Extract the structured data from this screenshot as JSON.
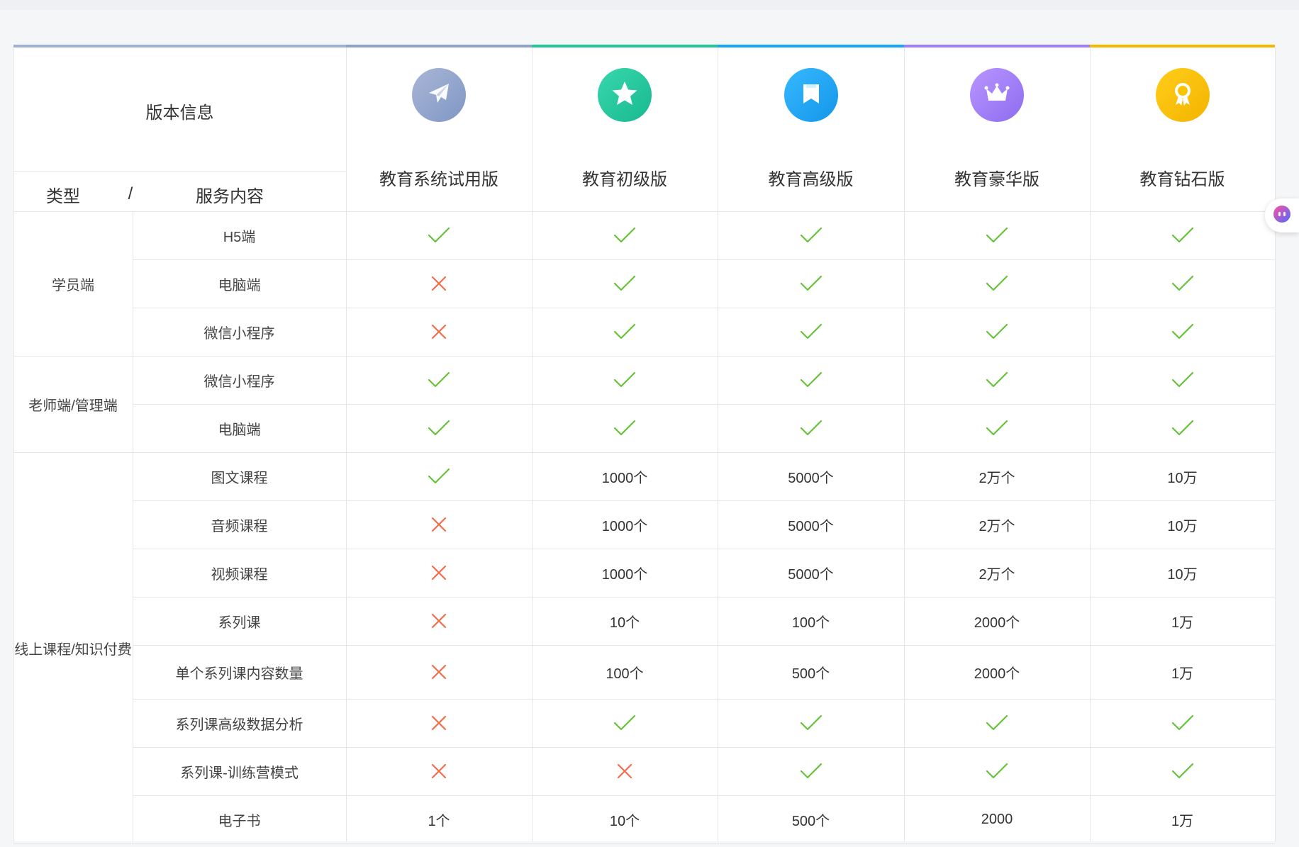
{
  "header": {
    "version_info": "版本信息",
    "type_label": "类型",
    "separator": "/",
    "service_label": "服务内容"
  },
  "plans": [
    {
      "name": "教育系统试用版",
      "icon": "paper-plane-icon",
      "color": "#8fa2c9",
      "gradient": [
        "#a9b6d6",
        "#7f97c4"
      ]
    },
    {
      "name": "教育初级版",
      "icon": "star-icon",
      "color": "#26c59a",
      "gradient": [
        "#38d7ad",
        "#19b98f"
      ]
    },
    {
      "name": "教育高级版",
      "icon": "bookmark-icon",
      "color": "#1aa6f1",
      "gradient": [
        "#36b8ff",
        "#1496ea"
      ]
    },
    {
      "name": "教育豪华版",
      "icon": "crown-icon",
      "color": "#a07ef5",
      "gradient": [
        "#b996ff",
        "#8d6cf0"
      ]
    },
    {
      "name": "教育钻石版",
      "icon": "medal-icon",
      "color": "#f5b800",
      "gradient": [
        "#ffcd1a",
        "#f3b400"
      ]
    }
  ],
  "categories": [
    {
      "label": "学员端",
      "rows": [
        {
          "service": "H5端",
          "values": [
            "✓",
            "✓",
            "✓",
            "✓",
            "✓"
          ]
        },
        {
          "service": "电脑端",
          "values": [
            "✗",
            "✓",
            "✓",
            "✓",
            "✓"
          ]
        },
        {
          "service": "微信小程序",
          "values": [
            "✗",
            "✓",
            "✓",
            "✓",
            "✓"
          ]
        }
      ]
    },
    {
      "label": "老师端/管理端",
      "rows": [
        {
          "service": "微信小程序",
          "values": [
            "✓",
            "✓",
            "✓",
            "✓",
            "✓"
          ]
        },
        {
          "service": "电脑端",
          "values": [
            "✓",
            "✓",
            "✓",
            "✓",
            "✓"
          ]
        }
      ]
    },
    {
      "label": "线上课程/知识付费",
      "rows": [
        {
          "service": "图文课程",
          "values": [
            "✓",
            "1000个",
            "5000个",
            "2万个",
            "10万"
          ]
        },
        {
          "service": "音频课程",
          "values": [
            "✗",
            "1000个",
            "5000个",
            "2万个",
            "10万"
          ]
        },
        {
          "service": "视频课程",
          "values": [
            "✗",
            "1000个",
            "5000个",
            "2万个",
            "10万"
          ]
        },
        {
          "service": "系列课",
          "values": [
            "✗",
            "10个",
            "100个",
            "2000个",
            "1万"
          ]
        },
        {
          "service": "单个系列课内容数量",
          "values": [
            "✗",
            "100个",
            "500个",
            "2000个",
            "1万"
          ]
        },
        {
          "service": "系列课高级数据分析",
          "values": [
            "✗",
            "✓",
            "✓",
            "✓",
            "✓"
          ]
        },
        {
          "service": "系列课-训练营模式",
          "values": [
            "✗",
            "✗",
            "✓",
            "✓",
            "✓"
          ]
        },
        {
          "service": "电子书",
          "values": [
            "1个",
            "10个",
            "500个",
            "2000",
            "1万"
          ]
        }
      ]
    }
  ],
  "colors": {
    "check": "#67c23a",
    "cross": "#f56c4a",
    "border": "#e6e6e6"
  },
  "floating_widget": {
    "icon": "assistant-bubble-icon"
  }
}
